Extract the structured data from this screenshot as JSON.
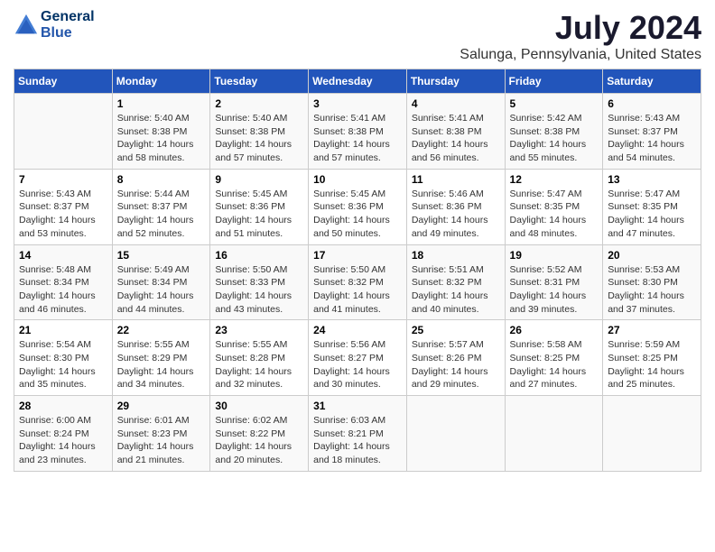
{
  "logo": {
    "line1": "General",
    "line2": "Blue"
  },
  "title": "July 2024",
  "subtitle": "Salunga, Pennsylvania, United States",
  "days_of_week": [
    "Sunday",
    "Monday",
    "Tuesday",
    "Wednesday",
    "Thursday",
    "Friday",
    "Saturday"
  ],
  "weeks": [
    [
      {
        "day": "",
        "info": ""
      },
      {
        "day": "1",
        "info": "Sunrise: 5:40 AM\nSunset: 8:38 PM\nDaylight: 14 hours\nand 58 minutes."
      },
      {
        "day": "2",
        "info": "Sunrise: 5:40 AM\nSunset: 8:38 PM\nDaylight: 14 hours\nand 57 minutes."
      },
      {
        "day": "3",
        "info": "Sunrise: 5:41 AM\nSunset: 8:38 PM\nDaylight: 14 hours\nand 57 minutes."
      },
      {
        "day": "4",
        "info": "Sunrise: 5:41 AM\nSunset: 8:38 PM\nDaylight: 14 hours\nand 56 minutes."
      },
      {
        "day": "5",
        "info": "Sunrise: 5:42 AM\nSunset: 8:38 PM\nDaylight: 14 hours\nand 55 minutes."
      },
      {
        "day": "6",
        "info": "Sunrise: 5:43 AM\nSunset: 8:37 PM\nDaylight: 14 hours\nand 54 minutes."
      }
    ],
    [
      {
        "day": "7",
        "info": "Sunrise: 5:43 AM\nSunset: 8:37 PM\nDaylight: 14 hours\nand 53 minutes."
      },
      {
        "day": "8",
        "info": "Sunrise: 5:44 AM\nSunset: 8:37 PM\nDaylight: 14 hours\nand 52 minutes."
      },
      {
        "day": "9",
        "info": "Sunrise: 5:45 AM\nSunset: 8:36 PM\nDaylight: 14 hours\nand 51 minutes."
      },
      {
        "day": "10",
        "info": "Sunrise: 5:45 AM\nSunset: 8:36 PM\nDaylight: 14 hours\nand 50 minutes."
      },
      {
        "day": "11",
        "info": "Sunrise: 5:46 AM\nSunset: 8:36 PM\nDaylight: 14 hours\nand 49 minutes."
      },
      {
        "day": "12",
        "info": "Sunrise: 5:47 AM\nSunset: 8:35 PM\nDaylight: 14 hours\nand 48 minutes."
      },
      {
        "day": "13",
        "info": "Sunrise: 5:47 AM\nSunset: 8:35 PM\nDaylight: 14 hours\nand 47 minutes."
      }
    ],
    [
      {
        "day": "14",
        "info": "Sunrise: 5:48 AM\nSunset: 8:34 PM\nDaylight: 14 hours\nand 46 minutes."
      },
      {
        "day": "15",
        "info": "Sunrise: 5:49 AM\nSunset: 8:34 PM\nDaylight: 14 hours\nand 44 minutes."
      },
      {
        "day": "16",
        "info": "Sunrise: 5:50 AM\nSunset: 8:33 PM\nDaylight: 14 hours\nand 43 minutes."
      },
      {
        "day": "17",
        "info": "Sunrise: 5:50 AM\nSunset: 8:32 PM\nDaylight: 14 hours\nand 41 minutes."
      },
      {
        "day": "18",
        "info": "Sunrise: 5:51 AM\nSunset: 8:32 PM\nDaylight: 14 hours\nand 40 minutes."
      },
      {
        "day": "19",
        "info": "Sunrise: 5:52 AM\nSunset: 8:31 PM\nDaylight: 14 hours\nand 39 minutes."
      },
      {
        "day": "20",
        "info": "Sunrise: 5:53 AM\nSunset: 8:30 PM\nDaylight: 14 hours\nand 37 minutes."
      }
    ],
    [
      {
        "day": "21",
        "info": "Sunrise: 5:54 AM\nSunset: 8:30 PM\nDaylight: 14 hours\nand 35 minutes."
      },
      {
        "day": "22",
        "info": "Sunrise: 5:55 AM\nSunset: 8:29 PM\nDaylight: 14 hours\nand 34 minutes."
      },
      {
        "day": "23",
        "info": "Sunrise: 5:55 AM\nSunset: 8:28 PM\nDaylight: 14 hours\nand 32 minutes."
      },
      {
        "day": "24",
        "info": "Sunrise: 5:56 AM\nSunset: 8:27 PM\nDaylight: 14 hours\nand 30 minutes."
      },
      {
        "day": "25",
        "info": "Sunrise: 5:57 AM\nSunset: 8:26 PM\nDaylight: 14 hours\nand 29 minutes."
      },
      {
        "day": "26",
        "info": "Sunrise: 5:58 AM\nSunset: 8:25 PM\nDaylight: 14 hours\nand 27 minutes."
      },
      {
        "day": "27",
        "info": "Sunrise: 5:59 AM\nSunset: 8:25 PM\nDaylight: 14 hours\nand 25 minutes."
      }
    ],
    [
      {
        "day": "28",
        "info": "Sunrise: 6:00 AM\nSunset: 8:24 PM\nDaylight: 14 hours\nand 23 minutes."
      },
      {
        "day": "29",
        "info": "Sunrise: 6:01 AM\nSunset: 8:23 PM\nDaylight: 14 hours\nand 21 minutes."
      },
      {
        "day": "30",
        "info": "Sunrise: 6:02 AM\nSunset: 8:22 PM\nDaylight: 14 hours\nand 20 minutes."
      },
      {
        "day": "31",
        "info": "Sunrise: 6:03 AM\nSunset: 8:21 PM\nDaylight: 14 hours\nand 18 minutes."
      },
      {
        "day": "",
        "info": ""
      },
      {
        "day": "",
        "info": ""
      },
      {
        "day": "",
        "info": ""
      }
    ]
  ]
}
